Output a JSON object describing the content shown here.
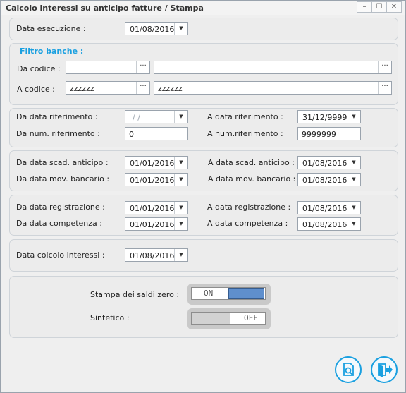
{
  "window": {
    "title": "Calcolo interessi su anticipo fatture / Stampa",
    "min": "–",
    "max": "☐",
    "close": "✕"
  },
  "execution": {
    "label": "Data esecuzione :",
    "value": "01/08/2016"
  },
  "banks": {
    "title": "Filtro banche :",
    "from_label": "Da codice :",
    "from_code": "",
    "from_desc": "",
    "to_label": "A codice :",
    "to_code": "zzzzzz",
    "to_desc": "zzzzzz",
    "more": "···"
  },
  "reference": {
    "from_date_label": "Da data riferimento :",
    "from_date": "/ /",
    "to_date_label": "A data riferimento :",
    "to_date": "31/12/9999",
    "from_num_label": "Da num. riferimento :",
    "from_num": "0",
    "to_num_label": "A num.riferimento :",
    "to_num": "9999999"
  },
  "advance": {
    "from_due_label": "Da data scad. anticipo :",
    "from_due": "01/01/2016",
    "to_due_label": "A data scad. anticipo :",
    "to_due": "01/08/2016",
    "from_mov_label": "Da data mov. bancario :",
    "from_mov": "01/01/2016",
    "to_mov_label": "A data mov. bancario :",
    "to_mov": "01/08/2016"
  },
  "registration": {
    "from_reg_label": "Da data registrazione :",
    "from_reg": "01/01/2016",
    "to_reg_label": "A data registrazione :",
    "to_reg": "01/08/2016",
    "from_comp_label": "Da data competenza :",
    "from_comp": "01/01/2016",
    "to_comp_label": "A data competenza :",
    "to_comp": "01/08/2016"
  },
  "interest": {
    "label": "Data colcolo interessi :",
    "value": "01/08/2016"
  },
  "options": {
    "zero_label": "Stampa dei saldi zero :",
    "zero_state": "ON",
    "synthetic_label": "Sintetico :",
    "synthetic_state": "OFF"
  },
  "dropdown_glyph": "▼",
  "icons": {
    "preview": "print-preview-icon",
    "exit": "exit-icon"
  },
  "colors": {
    "accent": "#1aa0e0",
    "toggle_on": "#5f8fcd"
  }
}
